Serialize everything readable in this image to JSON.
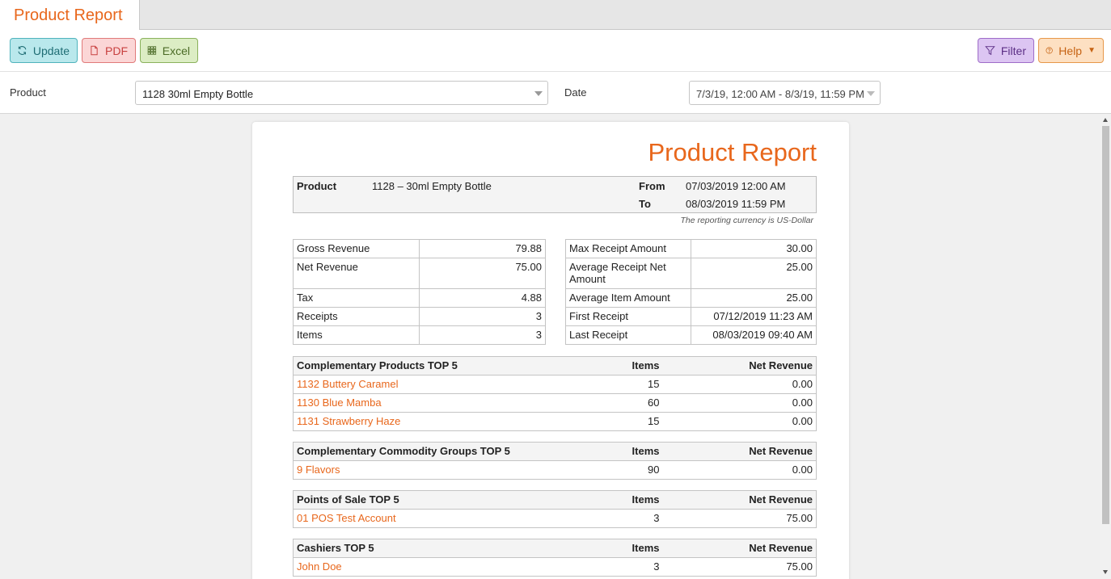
{
  "tab": {
    "title": "Product Report"
  },
  "toolbar": {
    "update": "Update",
    "pdf": "PDF",
    "excel": "Excel",
    "filter": "Filter",
    "help": "Help"
  },
  "filters": {
    "product_label": "Product",
    "product_value": "1128 30ml Empty Bottle",
    "date_label": "Date",
    "date_value": "7/3/19, 12:00 AM - 8/3/19, 11:59 PM"
  },
  "report": {
    "title": "Product Report",
    "product_label": "Product",
    "product_value": "1128 – 30ml Empty Bottle",
    "from_label": "From",
    "from_value": "07/03/2019 12:00 AM",
    "to_label": "To",
    "to_value": "08/03/2019 11:59 PM",
    "currency_note": "The reporting currency is US-Dollar",
    "left_stats": [
      {
        "label": "Gross Revenue",
        "value": "79.88"
      },
      {
        "label": "Net Revenue",
        "value": "75.00"
      },
      {
        "label": "Tax",
        "value": "4.88"
      },
      {
        "label": "Receipts",
        "value": "3"
      },
      {
        "label": "Items",
        "value": "3"
      }
    ],
    "right_stats": [
      {
        "label": "Max Receipt Amount",
        "value": "30.00"
      },
      {
        "label": "Average Receipt Net Amount",
        "value": "25.00"
      },
      {
        "label": "Average Item Amount",
        "value": "25.00"
      },
      {
        "label": "First Receipt",
        "value": "07/12/2019 11:23 AM"
      },
      {
        "label": "Last Receipt",
        "value": "08/03/2019 09:40 AM"
      }
    ],
    "complementary_products": {
      "header": "Complementary Products TOP 5",
      "col_items": "Items",
      "col_revenue": "Net Revenue",
      "rows": [
        {
          "name": "1132 Buttery Caramel",
          "items": "15",
          "revenue": "0.00"
        },
        {
          "name": "1130 Blue Mamba",
          "items": "60",
          "revenue": "0.00"
        },
        {
          "name": "1131 Strawberry Haze",
          "items": "15",
          "revenue": "0.00"
        }
      ]
    },
    "commodity_groups": {
      "header": "Complementary Commodity Groups TOP 5",
      "col_items": "Items",
      "col_revenue": "Net Revenue",
      "rows": [
        {
          "name": "9 Flavors",
          "items": "90",
          "revenue": "0.00"
        }
      ]
    },
    "points_of_sale": {
      "header": "Points of Sale TOP 5",
      "col_items": "Items",
      "col_revenue": "Net Revenue",
      "rows": [
        {
          "name": "01 POS Test Account",
          "items": "3",
          "revenue": "75.00"
        }
      ]
    },
    "cashiers": {
      "header": "Cashiers TOP 5",
      "col_items": "Items",
      "col_revenue": "Net Revenue",
      "rows": [
        {
          "name": "John Doe",
          "items": "3",
          "revenue": "75.00"
        }
      ]
    }
  },
  "colors": {
    "accent": "#e8671c"
  }
}
